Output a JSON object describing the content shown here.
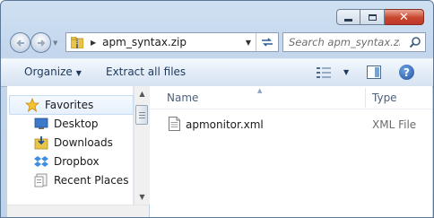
{
  "window": {
    "caption_buttons": {
      "close_glyph": "✕"
    }
  },
  "nav": {
    "back_icon": "back-arrow-icon",
    "forward_icon": "forward-arrow-icon",
    "address": {
      "segment": "apm_syntax.zip"
    },
    "search": {
      "placeholder": "Search apm_syntax.zip"
    }
  },
  "toolbar": {
    "organize_label": "Organize",
    "extract_label": "Extract all files",
    "help_glyph": "?"
  },
  "sidebar": {
    "favorites_label": "Favorites",
    "items": [
      {
        "label": "Desktop",
        "icon": "desktop-icon"
      },
      {
        "label": "Downloads",
        "icon": "downloads-icon"
      },
      {
        "label": "Dropbox",
        "icon": "dropbox-icon"
      },
      {
        "label": "Recent Places",
        "icon": "recent-places-icon"
      }
    ]
  },
  "content": {
    "columns": {
      "name": "Name",
      "type": "Type"
    },
    "files": [
      {
        "name": "apmonitor.xml",
        "type": "XML File"
      }
    ]
  },
  "colors": {
    "chrome": "#c3d6ec",
    "command_bar": "#e3ecf7",
    "accent_text": "#1e395b",
    "close_button": "#c8452c"
  }
}
